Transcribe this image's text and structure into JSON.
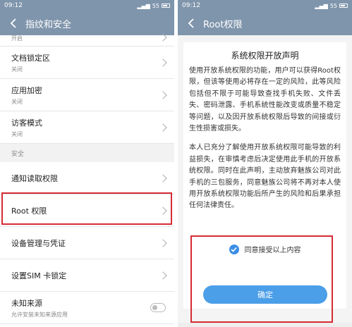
{
  "left": {
    "status": {
      "time": "09:12",
      "battery": "55"
    },
    "title": "指纹和安全",
    "items_top": [
      {
        "title": "",
        "sub": "开启"
      },
      {
        "title": "文档锁定区",
        "sub": "关闭"
      },
      {
        "title": "应用加密",
        "sub": "关闭"
      },
      {
        "title": "访客模式",
        "sub": "关闭"
      }
    ],
    "section": "安全",
    "items_security": [
      {
        "title": "通知读取权限"
      },
      {
        "title": "Root 权限"
      },
      {
        "title": "设备管理与凭证"
      },
      {
        "title": "设置SIM 卡锁定"
      },
      {
        "title": "未知来源",
        "sub": "允许安装未知来源应用"
      }
    ]
  },
  "right": {
    "status": {
      "time": "09:12",
      "battery": "55"
    },
    "title": "Root权限",
    "dialog_title": "系统权限开放声明",
    "para1": "使用开放系统权限的功能，用户可以获得Root权限，但该等使用必将存在一定的风险，此等风险包括但不限于可能导致查找手机失败、文件丢失、密码泄露、手机系统性能改变或质量不稳定等问题，以及因开放系统权限后导致的间接或衍生性损害或损失。",
    "para2": "本人已充分了解使用开放系统权限可能导致的利益损失，在审慎考虑后决定使用此手机的开放系统权限。同时在此声明，主动放弃魅族公司对此手机的三包服务，同意魅族公司将不再对本人使用开放系统权限功能后所产生的风险和后果承担任何法律责任。",
    "agree_label": "同意接受以上内容",
    "confirm_label": "确定"
  },
  "colors": {
    "header": "#7f95ac",
    "highlight": "#d62b34",
    "accent": "#4b9ee8"
  }
}
